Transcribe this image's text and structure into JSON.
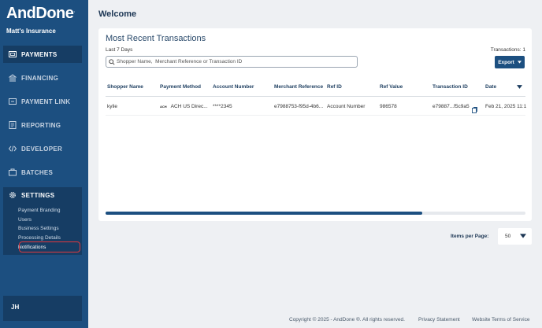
{
  "brand": {
    "logo": "AndDone",
    "logo_mark": ".",
    "org_name": "Matt's Insurance"
  },
  "colors": {
    "sidebar": "#1c4f80",
    "sidebar_active": "#163d64",
    "accent": "#1c4f80",
    "highlight": "#e0383e"
  },
  "nav": {
    "items": [
      {
        "label": "PAYMENTS",
        "icon": "payments-icon"
      },
      {
        "label": "FINANCING",
        "icon": "bank-icon"
      },
      {
        "label": "PAYMENT LINK",
        "icon": "link-icon"
      },
      {
        "label": "REPORTING",
        "icon": "report-icon"
      },
      {
        "label": "DEVELOPER",
        "icon": "code-icon"
      },
      {
        "label": "BATCHES",
        "icon": "batch-icon"
      }
    ],
    "settings": {
      "label": "SETTINGS",
      "icon": "gear-icon",
      "sub_items": [
        "Payment Branding",
        "Users",
        "Business Settings",
        "Processing Details",
        "Notifications"
      ]
    }
  },
  "user": {
    "initials": "JH"
  },
  "page": {
    "title": "Welcome"
  },
  "transactions": {
    "title": "Most Recent Transactions",
    "period": "Last 7 Days",
    "count_label": "Transactions: 1",
    "search_placeholder": "Shopper Name,  Merchant Reference or Transaction ID",
    "export_label": "Export",
    "columns": [
      "Shopper Name",
      "Payment Method",
      "Account Number",
      "Merchant Reference",
      "Ref ID",
      "Ref Value",
      "Transaction ID",
      "Date"
    ],
    "rows": [
      {
        "shopper": "kylie",
        "pm_logo": "ACH",
        "method": "ACH US Direc...",
        "account": "****2345",
        "merchant_ref": "e7988753-f95d-4b6...",
        "ref_id": "Account Number",
        "ref_value": "986578",
        "transaction_id": "e79887...f5c9a5",
        "date": "Feb 21, 2025 11:1"
      }
    ],
    "scroll_fraction": 0.755
  },
  "pagination": {
    "label": "Items per Page:",
    "value": "50"
  },
  "footer": {
    "copyright": "Copyright © 2025 - AndDone ®. All rights reserved.",
    "privacy": "Privacy Statement",
    "terms": "Website Terms of Service"
  }
}
